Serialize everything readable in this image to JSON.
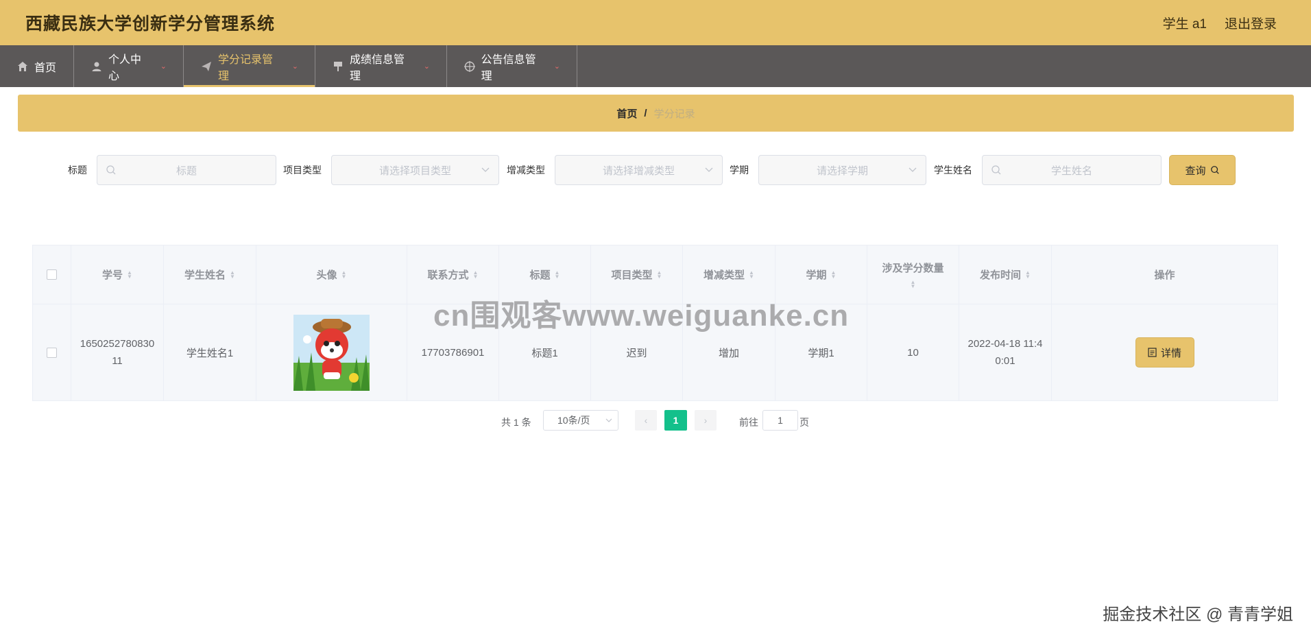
{
  "header": {
    "title": "西藏民族大学创新学分管理系统",
    "user": "学生 a1",
    "logout": "退出登录"
  },
  "nav": {
    "items": [
      {
        "label": "首页",
        "icon": "home-icon"
      },
      {
        "label": "个人中心",
        "icon": "user-icon"
      },
      {
        "label": "学分记录管理",
        "icon": "paper-plane-icon",
        "active": true
      },
      {
        "label": "成绩信息管理",
        "icon": "flag-icon"
      },
      {
        "label": "公告信息管理",
        "icon": "compass-icon"
      }
    ]
  },
  "breadcrumb": {
    "home": "首页",
    "separator": "/",
    "current": "学分记录"
  },
  "search": {
    "fields": [
      {
        "label": "标题",
        "placeholder": "标题"
      },
      {
        "label": "项目类型",
        "placeholder": "请选择项目类型"
      },
      {
        "label": "增减类型",
        "placeholder": "请选择增减类型"
      },
      {
        "label": "学期",
        "placeholder": "请选择学期"
      },
      {
        "label": "学生姓名",
        "placeholder": "学生姓名"
      }
    ],
    "query_label": "查询"
  },
  "table": {
    "columns": [
      "学号",
      "学生姓名",
      "头像",
      "联系方式",
      "标题",
      "项目类型",
      "增减类型",
      "学期",
      "涉及学分数量",
      "发布时间",
      "操作"
    ],
    "rows": [
      {
        "student_id": "165025278083011",
        "name": "学生姓名1",
        "avatar": "cartoon-fox-avatar",
        "contact": "17703786901",
        "title": "标题1",
        "project_type": "迟到",
        "change_type": "增加",
        "term": "学期1",
        "credits": "10",
        "published": "2022-04-18 11:40:01",
        "action_label": "详情"
      }
    ]
  },
  "pagination": {
    "total": "共 1 条",
    "page_size": "10条/页",
    "current": "1",
    "goto_label": "前往",
    "goto_value": "1",
    "page_suffix": "页"
  },
  "watermarks": {
    "center": "cn围观客www.weiguanke.cn",
    "bottom": "掘金技术社区 @ 青青学姐"
  },
  "colors": {
    "primary": "#e7c36c",
    "nav_bg": "#5b5858",
    "pager_active": "#13c08b"
  }
}
